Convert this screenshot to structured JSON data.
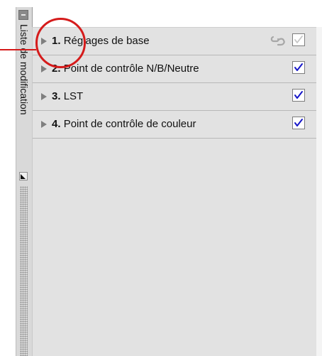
{
  "sidebar": {
    "title": "Liste de modification",
    "collapse_icon": "minus-box-icon",
    "resize_icon": "resize-corner-icon"
  },
  "steps": [
    {
      "number": "1.",
      "label": "Réglages de base",
      "checked": true,
      "enabled": false,
      "link_icon": "chain-link-icon"
    },
    {
      "number": "2.",
      "label": "Point de contrôle N/B/Neutre",
      "checked": true,
      "enabled": true
    },
    {
      "number": "3.",
      "label": "LST",
      "checked": true,
      "enabled": true
    },
    {
      "number": "4.",
      "label": "Point de contrôle de couleur",
      "checked": true,
      "enabled": true
    }
  ],
  "annotation": {
    "type": "red-circle-callout",
    "target": "1."
  },
  "colors": {
    "panel_bg": "#e2e2e2",
    "row_divider": "#b8b8b8",
    "checkmark_active": "#1616c8",
    "checkmark_disabled": "#c6c6c6",
    "annotation_red": "#d51b1b"
  }
}
